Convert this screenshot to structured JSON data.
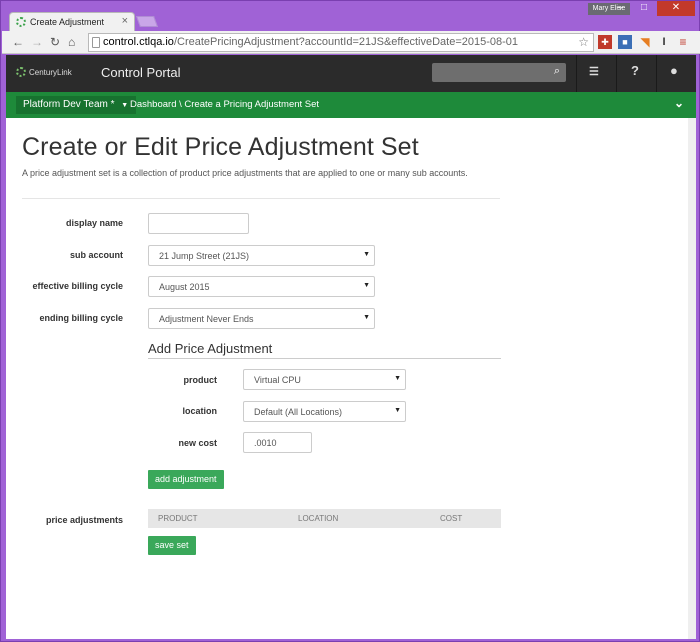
{
  "browser": {
    "tab_title": "Create Adjustment",
    "user_name": "Mary Elise",
    "url_host": "control.ctlqa.io",
    "url_path": "/CreatePricingAdjustment?accountId=21JS&effectiveDate=2015-08-01"
  },
  "header": {
    "logo_text": "CenturyLink",
    "portal_title": "Control Portal",
    "search_value": ""
  },
  "nav": {
    "team_label": "Platform Dev Team *",
    "breadcrumb": "Dashboard \\ Create a Pricing Adjustment Set"
  },
  "page": {
    "title": "Create or Edit Price Adjustment Set",
    "description": "A price adjustment set is a collection of product price adjustments that are applied to one or many sub accounts."
  },
  "form": {
    "display_name_label": "display name",
    "display_name_value": "",
    "sub_account_label": "sub account",
    "sub_account_value": "21 Jump Street (21JS)",
    "effective_label": "effective billing cycle",
    "effective_value": "August 2015",
    "ending_label": "ending billing cycle",
    "ending_value": "Adjustment Never Ends"
  },
  "adjustment": {
    "section_title": "Add Price Adjustment",
    "product_label": "product",
    "product_value": "Virtual CPU",
    "location_label": "location",
    "location_value": "Default (All Locations)",
    "cost_label": "new cost",
    "cost_value": ".0010",
    "add_button": "add adjustment"
  },
  "price_table": {
    "label": "price adjustments",
    "columns": [
      "PRODUCT",
      "LOCATION",
      "COST"
    ],
    "save_button": "save set"
  },
  "colors": {
    "accent_green": "#1e8a3a",
    "button_green": "#3aa85a",
    "header_dark": "#2b2b2b",
    "window_purple": "#a062d6"
  }
}
